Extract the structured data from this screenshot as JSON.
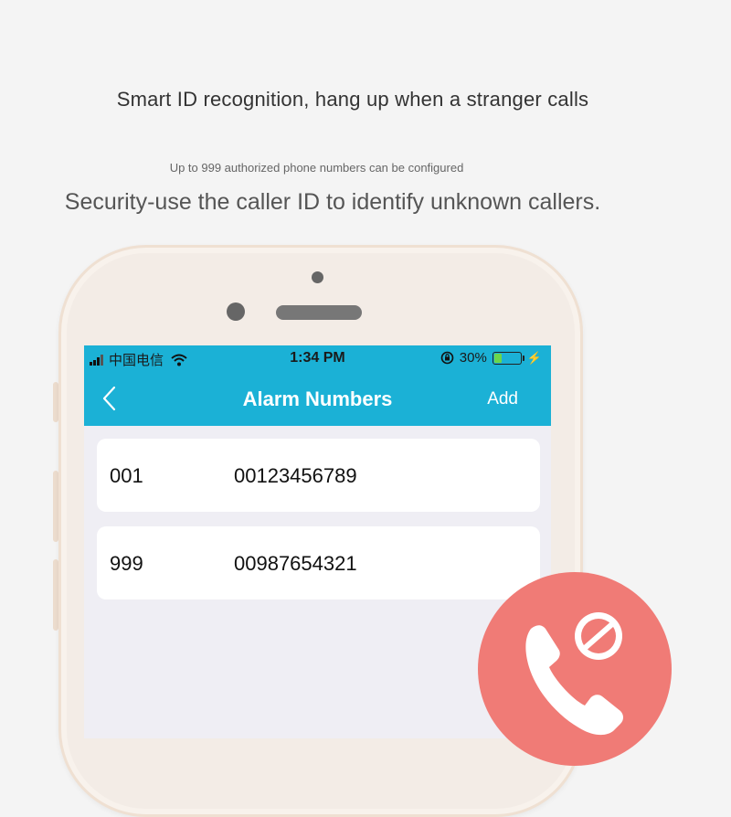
{
  "promo": {
    "headline": "Smart ID recognition, hang up when a stranger calls",
    "subnote": "Up to 999 authorized phone numbers can be configured",
    "tagline": "Security-use the caller ID to identify unknown callers."
  },
  "statusbar": {
    "carrier": "中国电信",
    "time": "1:34 PM",
    "battery": "30%",
    "battery_level": 0.3,
    "icons": [
      "signal-icon",
      "wifi-icon",
      "rotation-lock-icon",
      "battery-icon",
      "charging-icon"
    ]
  },
  "navbar": {
    "title": "Alarm Numbers",
    "add_label": "Add",
    "back_icon": "chevron-left-icon"
  },
  "alarm_numbers": [
    {
      "index": "001",
      "number": "00123456789"
    },
    {
      "index": "999",
      "number": "00987654321"
    }
  ],
  "colors": {
    "accent": "#1bb1d6",
    "badge": "#f07b76",
    "battery_fill": "#6bd64a"
  },
  "badge_icon": "blocked-call-icon"
}
